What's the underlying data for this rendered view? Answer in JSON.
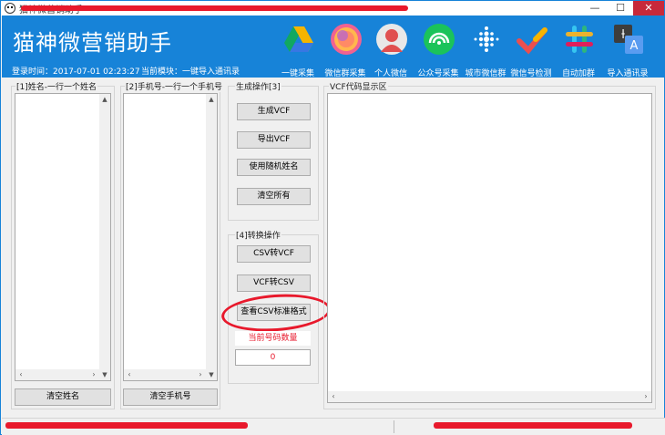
{
  "window": {
    "title": "猫神微营销助手",
    "min_glyph": "—",
    "max_glyph": "☐",
    "close_glyph": "✕"
  },
  "header": {
    "brand": "猫神微营销助手",
    "login_time": "登录时间：2017-07-01 02:23:27",
    "current_module": "当前模块：一键导入通讯录",
    "tools": [
      {
        "label": "一键采集",
        "icon": "triangle-drive-icon"
      },
      {
        "label": "微信群采集",
        "icon": "colorful-circle-icon"
      },
      {
        "label": "个人微信",
        "icon": "person-icon"
      },
      {
        "label": "公众号采集",
        "icon": "wifi-circle-icon"
      },
      {
        "label": "城市微信群",
        "icon": "dots-grid-icon"
      },
      {
        "label": "微信号检测",
        "icon": "checkmark-icon"
      },
      {
        "label": "自动加群",
        "icon": "hashtag-icon"
      },
      {
        "label": "导入通讯录",
        "icon": "translate-icon"
      }
    ]
  },
  "names_panel": {
    "label": "[1]姓名-一行一个姓名",
    "clear_button": "清空姓名"
  },
  "phones_panel": {
    "label": "[2]手机号-一行一个手机号",
    "clear_button": "清空手机号"
  },
  "generate_panel": {
    "label": "生成操作[3]",
    "buttons": [
      "生成VCF",
      "导出VCF",
      "使用随机姓名",
      "清空所有"
    ]
  },
  "convert_panel": {
    "label": "[4]转换操作",
    "buttons": [
      "CSV转VCF",
      "VCF转CSV",
      "查看CSV标准格式"
    ],
    "count_label": "当前号码数量",
    "count_value": "0"
  },
  "vcf_panel": {
    "label": "VCF代码显示区"
  },
  "colors": {
    "header_bg": "#1783d8",
    "annotation_red": "#e8192c"
  }
}
